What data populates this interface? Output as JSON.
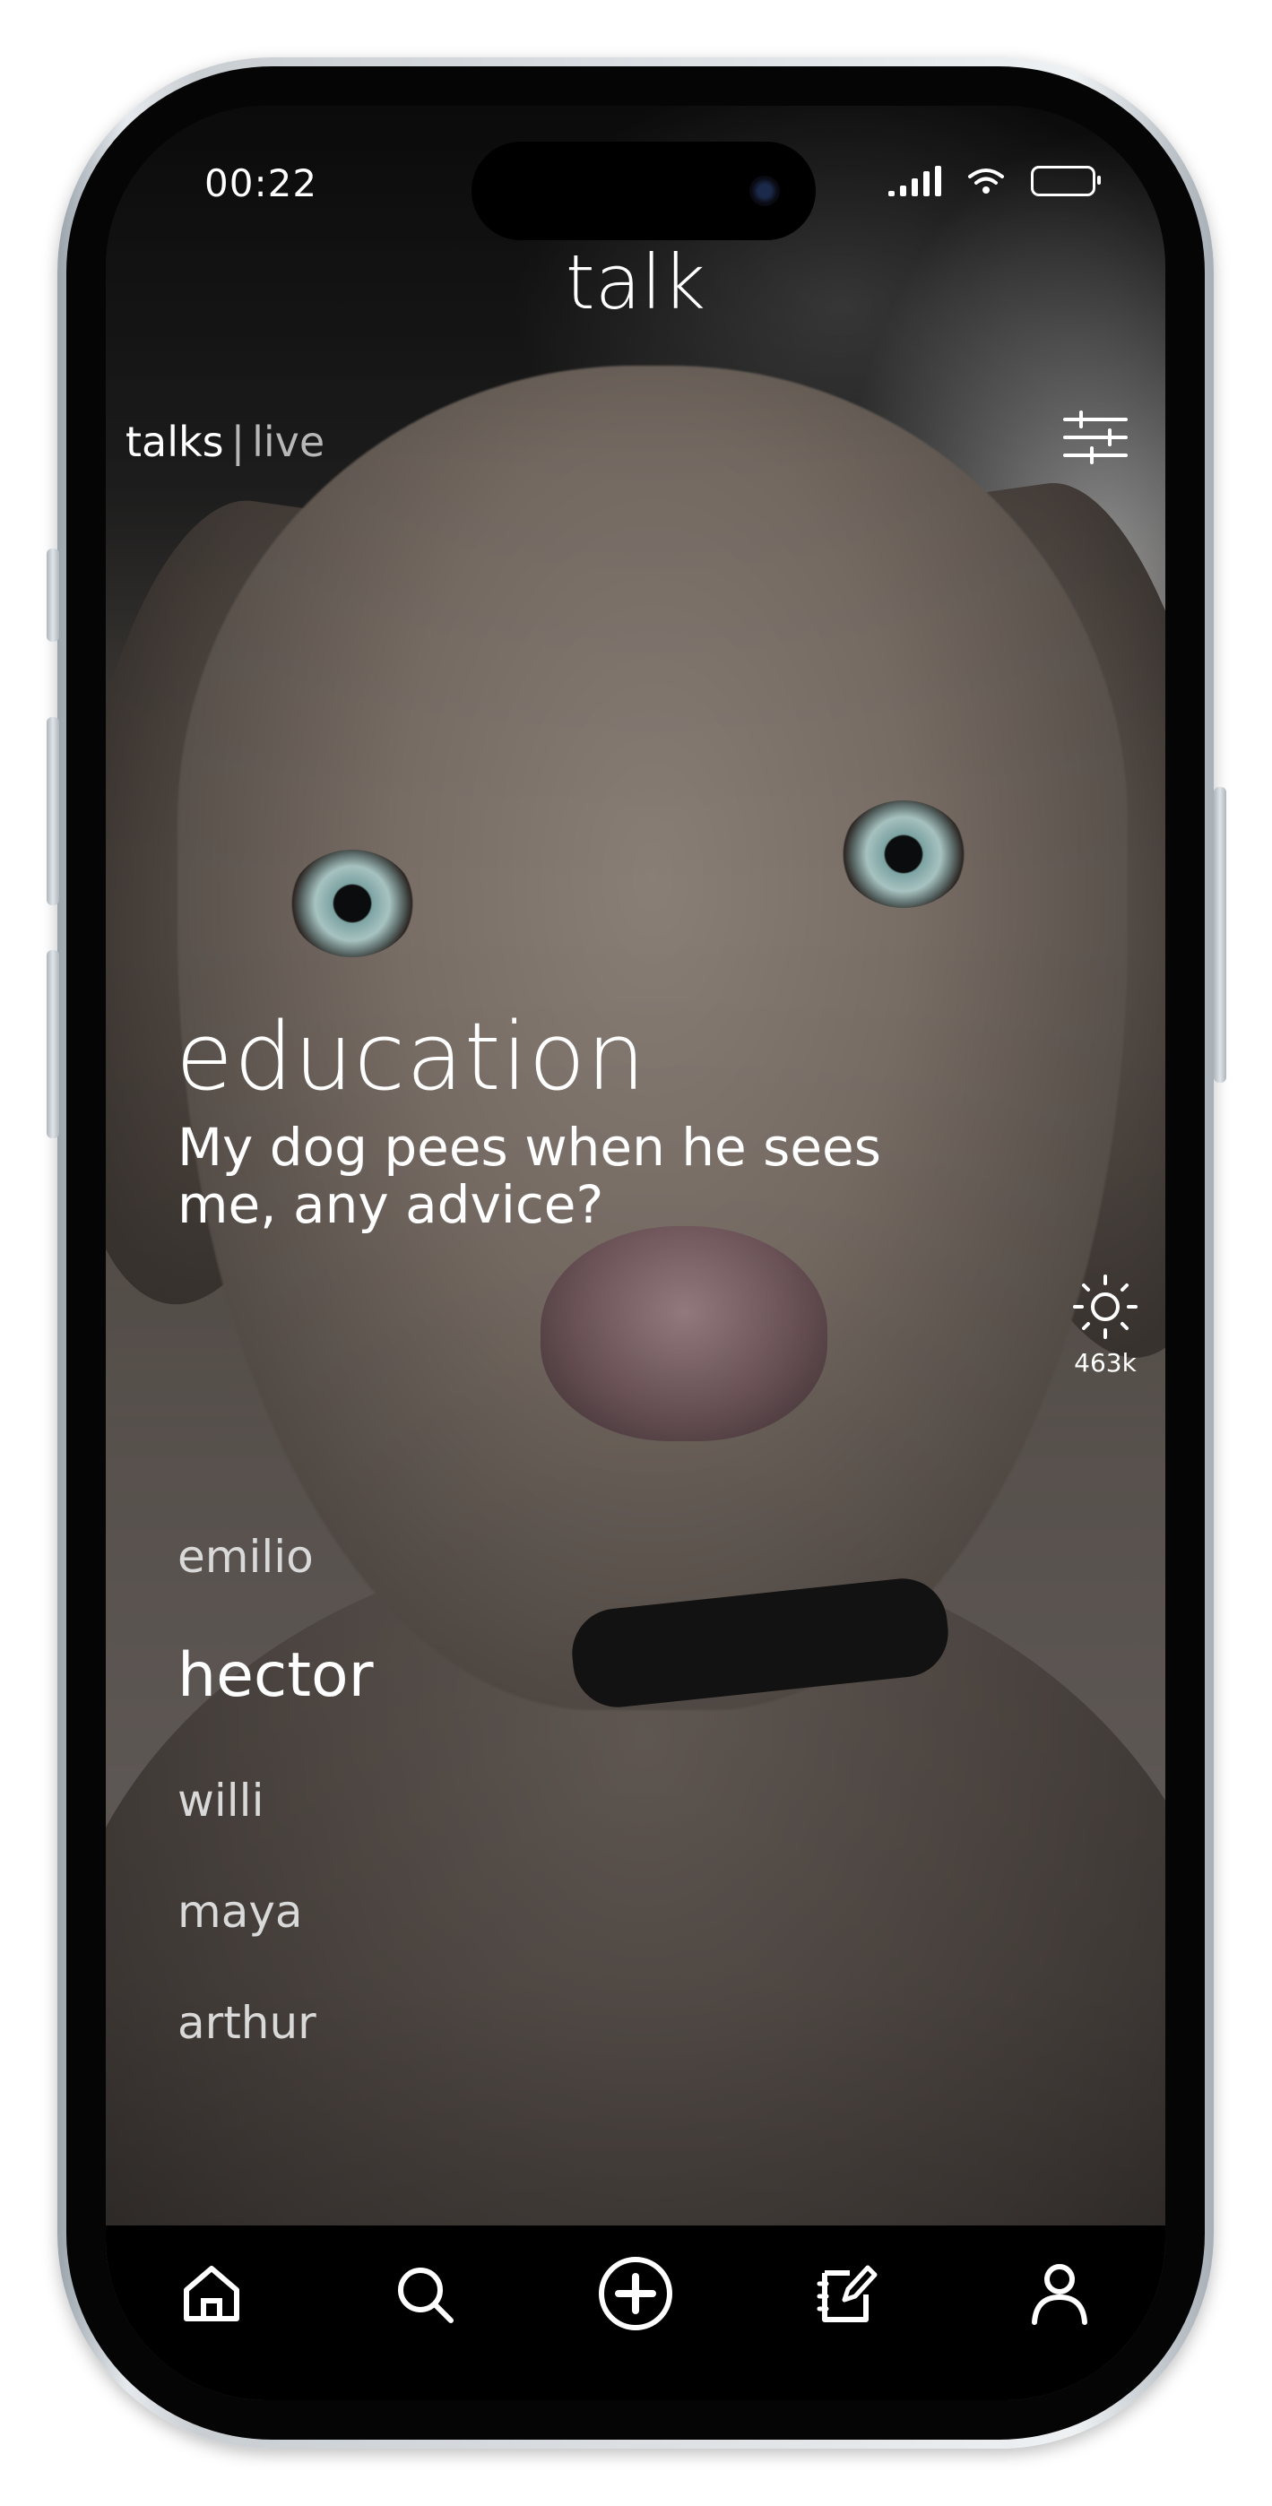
{
  "status_bar": {
    "time": "00:22"
  },
  "header": {
    "title": "talk"
  },
  "tabs": {
    "active": "talks",
    "separator": "|",
    "inactive": "live"
  },
  "post": {
    "category": "education",
    "question": "My dog pees when he sees me, any advice?",
    "likes": "463k"
  },
  "users": [
    "emilio",
    "hector",
    "willi",
    "maya",
    "arthur"
  ],
  "active_user": "hector",
  "nav": {
    "items": [
      "home-icon",
      "search-icon",
      "add-icon",
      "notes-icon",
      "profile-icon"
    ]
  },
  "colors": {
    "text": "#ffffff",
    "muted": "#b7b7b7",
    "nav_bg": "#000000"
  }
}
